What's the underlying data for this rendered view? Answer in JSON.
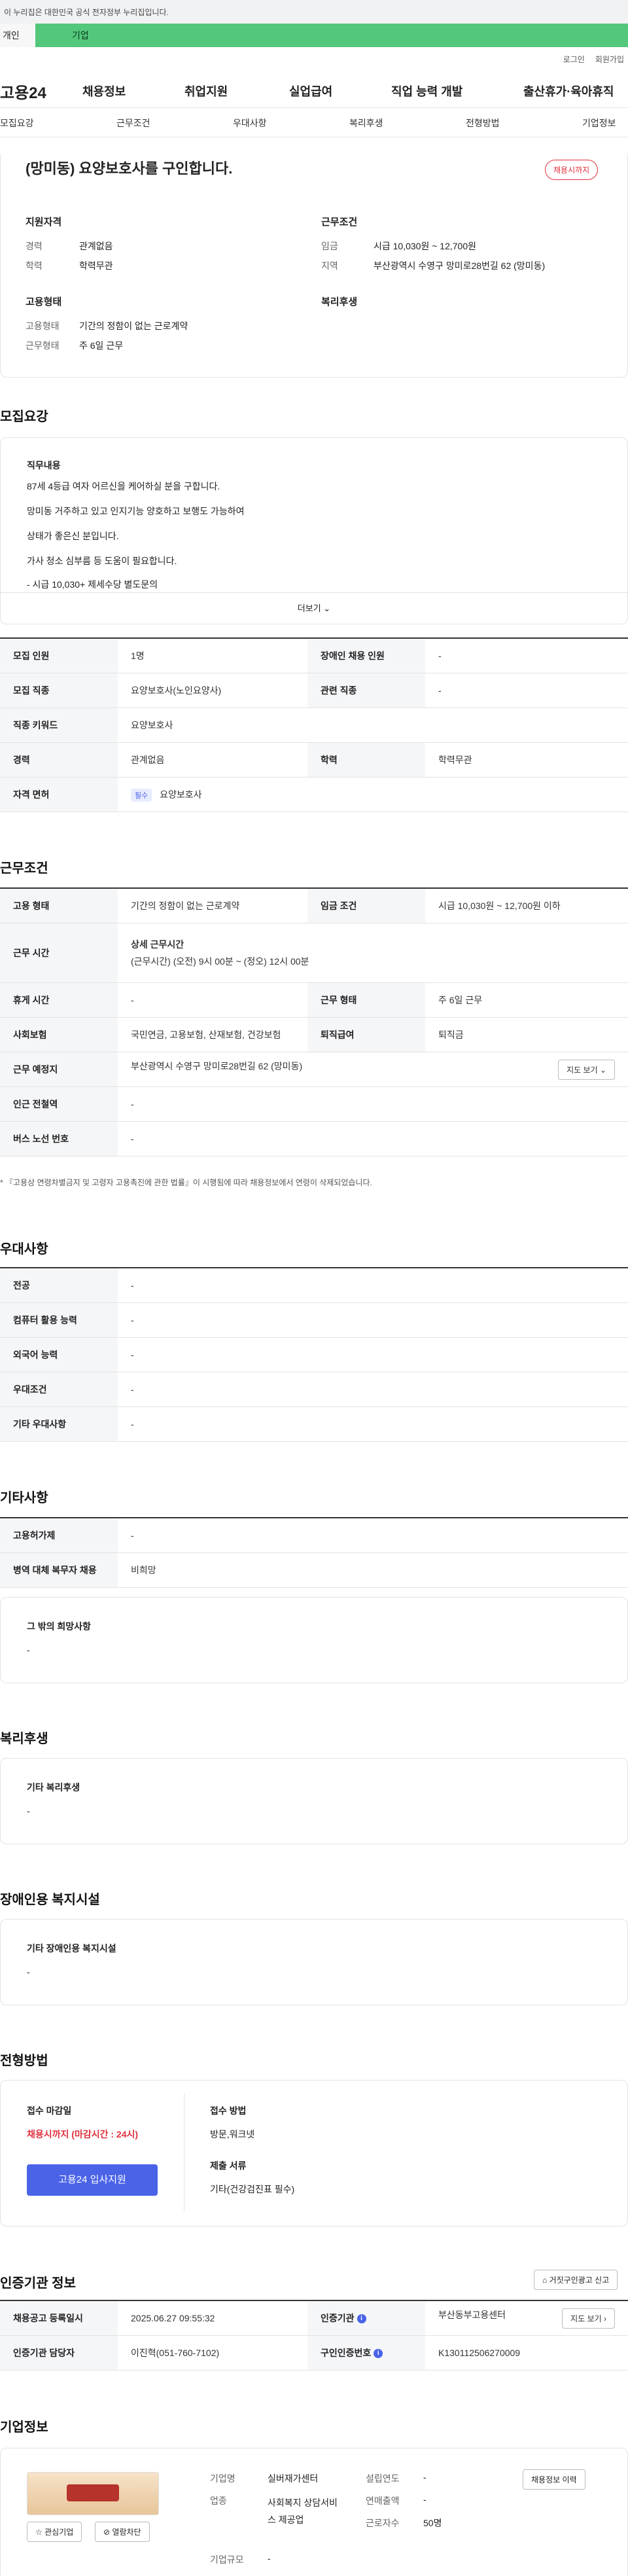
{
  "gov_notice": "이 누리집은 대한민국 공식 전자정부 누리집입니다.",
  "top_tabs": [
    "개인",
    "기업"
  ],
  "util_links": [
    "로그인",
    "회원가입"
  ],
  "logo": "고용24",
  "gnb": [
    "채용정보",
    "취업지원",
    "실업급여",
    "직업 능력 개발",
    "출산휴가·육아휴직"
  ],
  "subnav": [
    "모집요강",
    "근무조건",
    "우대사항",
    "복리후생",
    "전형방법",
    "기업정보"
  ],
  "summary": {
    "title": "(망미동) 요양보호사를 구인합니다.",
    "deadline_badge": "채용시까지",
    "qualification_head": "지원자격",
    "career_label": "경력",
    "career_value": "관계없음",
    "edu_label": "학력",
    "edu_value": "학력무관",
    "employ_head": "고용형태",
    "employ_label": "고용형태",
    "employ_value": "기간의 정함이 없는 근로계약",
    "workform_label": "근무형태",
    "workform_value": "주 6일 근무",
    "cond_head": "근무조건",
    "wage_label": "임금",
    "wage_value": "시급 10,030원 ~ 12,700원",
    "region_label": "지역",
    "region_value": "부산광역시 수영구 망미로28번길 62 (망미동)",
    "welfare_head": "복리후생"
  },
  "recruit": {
    "title": "모집요강",
    "duty_head": "직무내용",
    "duty_lines": [
      "87세 4등급 여자 어르신을 케어하실 분을 구합니다.",
      "망미동 거주하고 있고 인지기능 양호하고 보행도 가능하여",
      "상태가 좋은신 분입니다.",
      "가사 청소 심부름 등 도움이 필요합니다.",
      "- 시급 10,030+ 제세수당 별도문의"
    ],
    "more": "더보기",
    "rows": [
      {
        "k1": "모집 인원",
        "v1": "1명",
        "k2": "장애인 채용 인원",
        "v2": "-"
      },
      {
        "k1": "모집 직종",
        "v1": "요양보호사(노인요양사)",
        "k2": "관련 직종",
        "v2": "-"
      }
    ],
    "keyword_label": "직종 키워드",
    "keyword_value": "요양보호사",
    "career_label": "경력",
    "career_value": "관계없음",
    "edu_label": "학력",
    "edu_value": "학력무관",
    "license_label": "자격 면허",
    "license_tag": "필수",
    "license_value": "요양보호사"
  },
  "work": {
    "title": "근무조건",
    "type_label": "고용 형태",
    "type_value": "기간의 정함이 없는 근로계약",
    "wage_label": "임금 조건",
    "wage_value": "시급 10,030원 ~ 12,700원 이하",
    "hours_label": "근무 시간",
    "hours_head": "상세 근무시간",
    "hours_value": "(근무시간) (오전) 9시 00분 ~ (정오) 12시 00분",
    "break_label": "휴게 시간",
    "break_value": "-",
    "form_label": "근무 형태",
    "form_value": "주 6일 근무",
    "insurance_label": "사회보험",
    "insurance_value": "국민연금, 고용보험, 산재보험, 건강보험",
    "severance_label": "퇴직급여",
    "severance_value": "퇴직금",
    "place_label": "근무 예정지",
    "place_value": "부산광역시 수영구 망미로28번길 62 (망미동)",
    "map_btn": "지도 보기",
    "station_label": "인근 전철역",
    "station_value": "-",
    "bus_label": "버스 노선 번호",
    "bus_value": "-",
    "note": "* 『고용상 연령차별금지 및 고령자 고용촉진에 관한 법률』이 시행됨에 따라 채용정보에서 연령이 삭제되었습니다."
  },
  "pref": {
    "title": "우대사항",
    "rows": [
      {
        "k": "전공",
        "v": "-"
      },
      {
        "k": "컴퓨터 활용 능력",
        "v": "-"
      },
      {
        "k": "외국어 능력",
        "v": "-"
      },
      {
        "k": "우대조건",
        "v": "-"
      },
      {
        "k": "기타 우대사항",
        "v": "-"
      }
    ]
  },
  "etc": {
    "title": "기타사항",
    "rows": [
      {
        "k": "고용허가제",
        "v": "-"
      },
      {
        "k": "병역 대체 복무자 채용",
        "v": "비희망"
      }
    ],
    "other_head": "그 밖의 희망사항",
    "other_value": "-"
  },
  "welfare": {
    "title": "복리후생",
    "head": "기타 복리후생",
    "value": "-"
  },
  "disabled": {
    "title": "장애인용 복지시설",
    "head": "기타 장애인용 복지시설",
    "value": "-"
  },
  "selection": {
    "title": "전형방법",
    "deadline_head": "접수 마감일",
    "deadline_value": "채용시까지 (마감시간 : 24시)",
    "apply_btn": "고용24 입사지원",
    "method_head": "접수 방법",
    "method_value": "방문,워크넷",
    "docs_head": "제출 서류",
    "docs_value": "기타(건강검진표 필수)"
  },
  "agency": {
    "title": "인증기관 정보",
    "report_btn": "거짓구인광고 신고",
    "reg_label": "채용공고 등록일시",
    "reg_value": "2025.06.27 09:55:32",
    "org_label": "인증기관",
    "org_value": "부산동부고용센터",
    "map_btn": "지도 보기",
    "manager_label": "인증기관 담당자",
    "manager_value": "이진혁(051-760-7102)",
    "cert_label": "구인인증번호",
    "cert_value": "K130112506270009"
  },
  "company": {
    "title": "기업정보",
    "fav_btn": "관심기업",
    "block_btn": "열람차단",
    "name_label": "기업명",
    "name_value": "실버재가센터",
    "industry_label": "업종",
    "industry_value": "사회복지 상담서비스 제공업",
    "size_label": "기업규모",
    "size_value": "-",
    "founded_label": "설립연도",
    "founded_value": "-",
    "sales_label": "연매출액",
    "sales_value": "-",
    "staff_label": "근로자수",
    "staff_value": "50명",
    "history_btn": "채용정보 이력"
  },
  "colors": {
    "accent": "#4a63e7",
    "deadline_red": "#e0303d",
    "tab_green": "#53c77b"
  }
}
